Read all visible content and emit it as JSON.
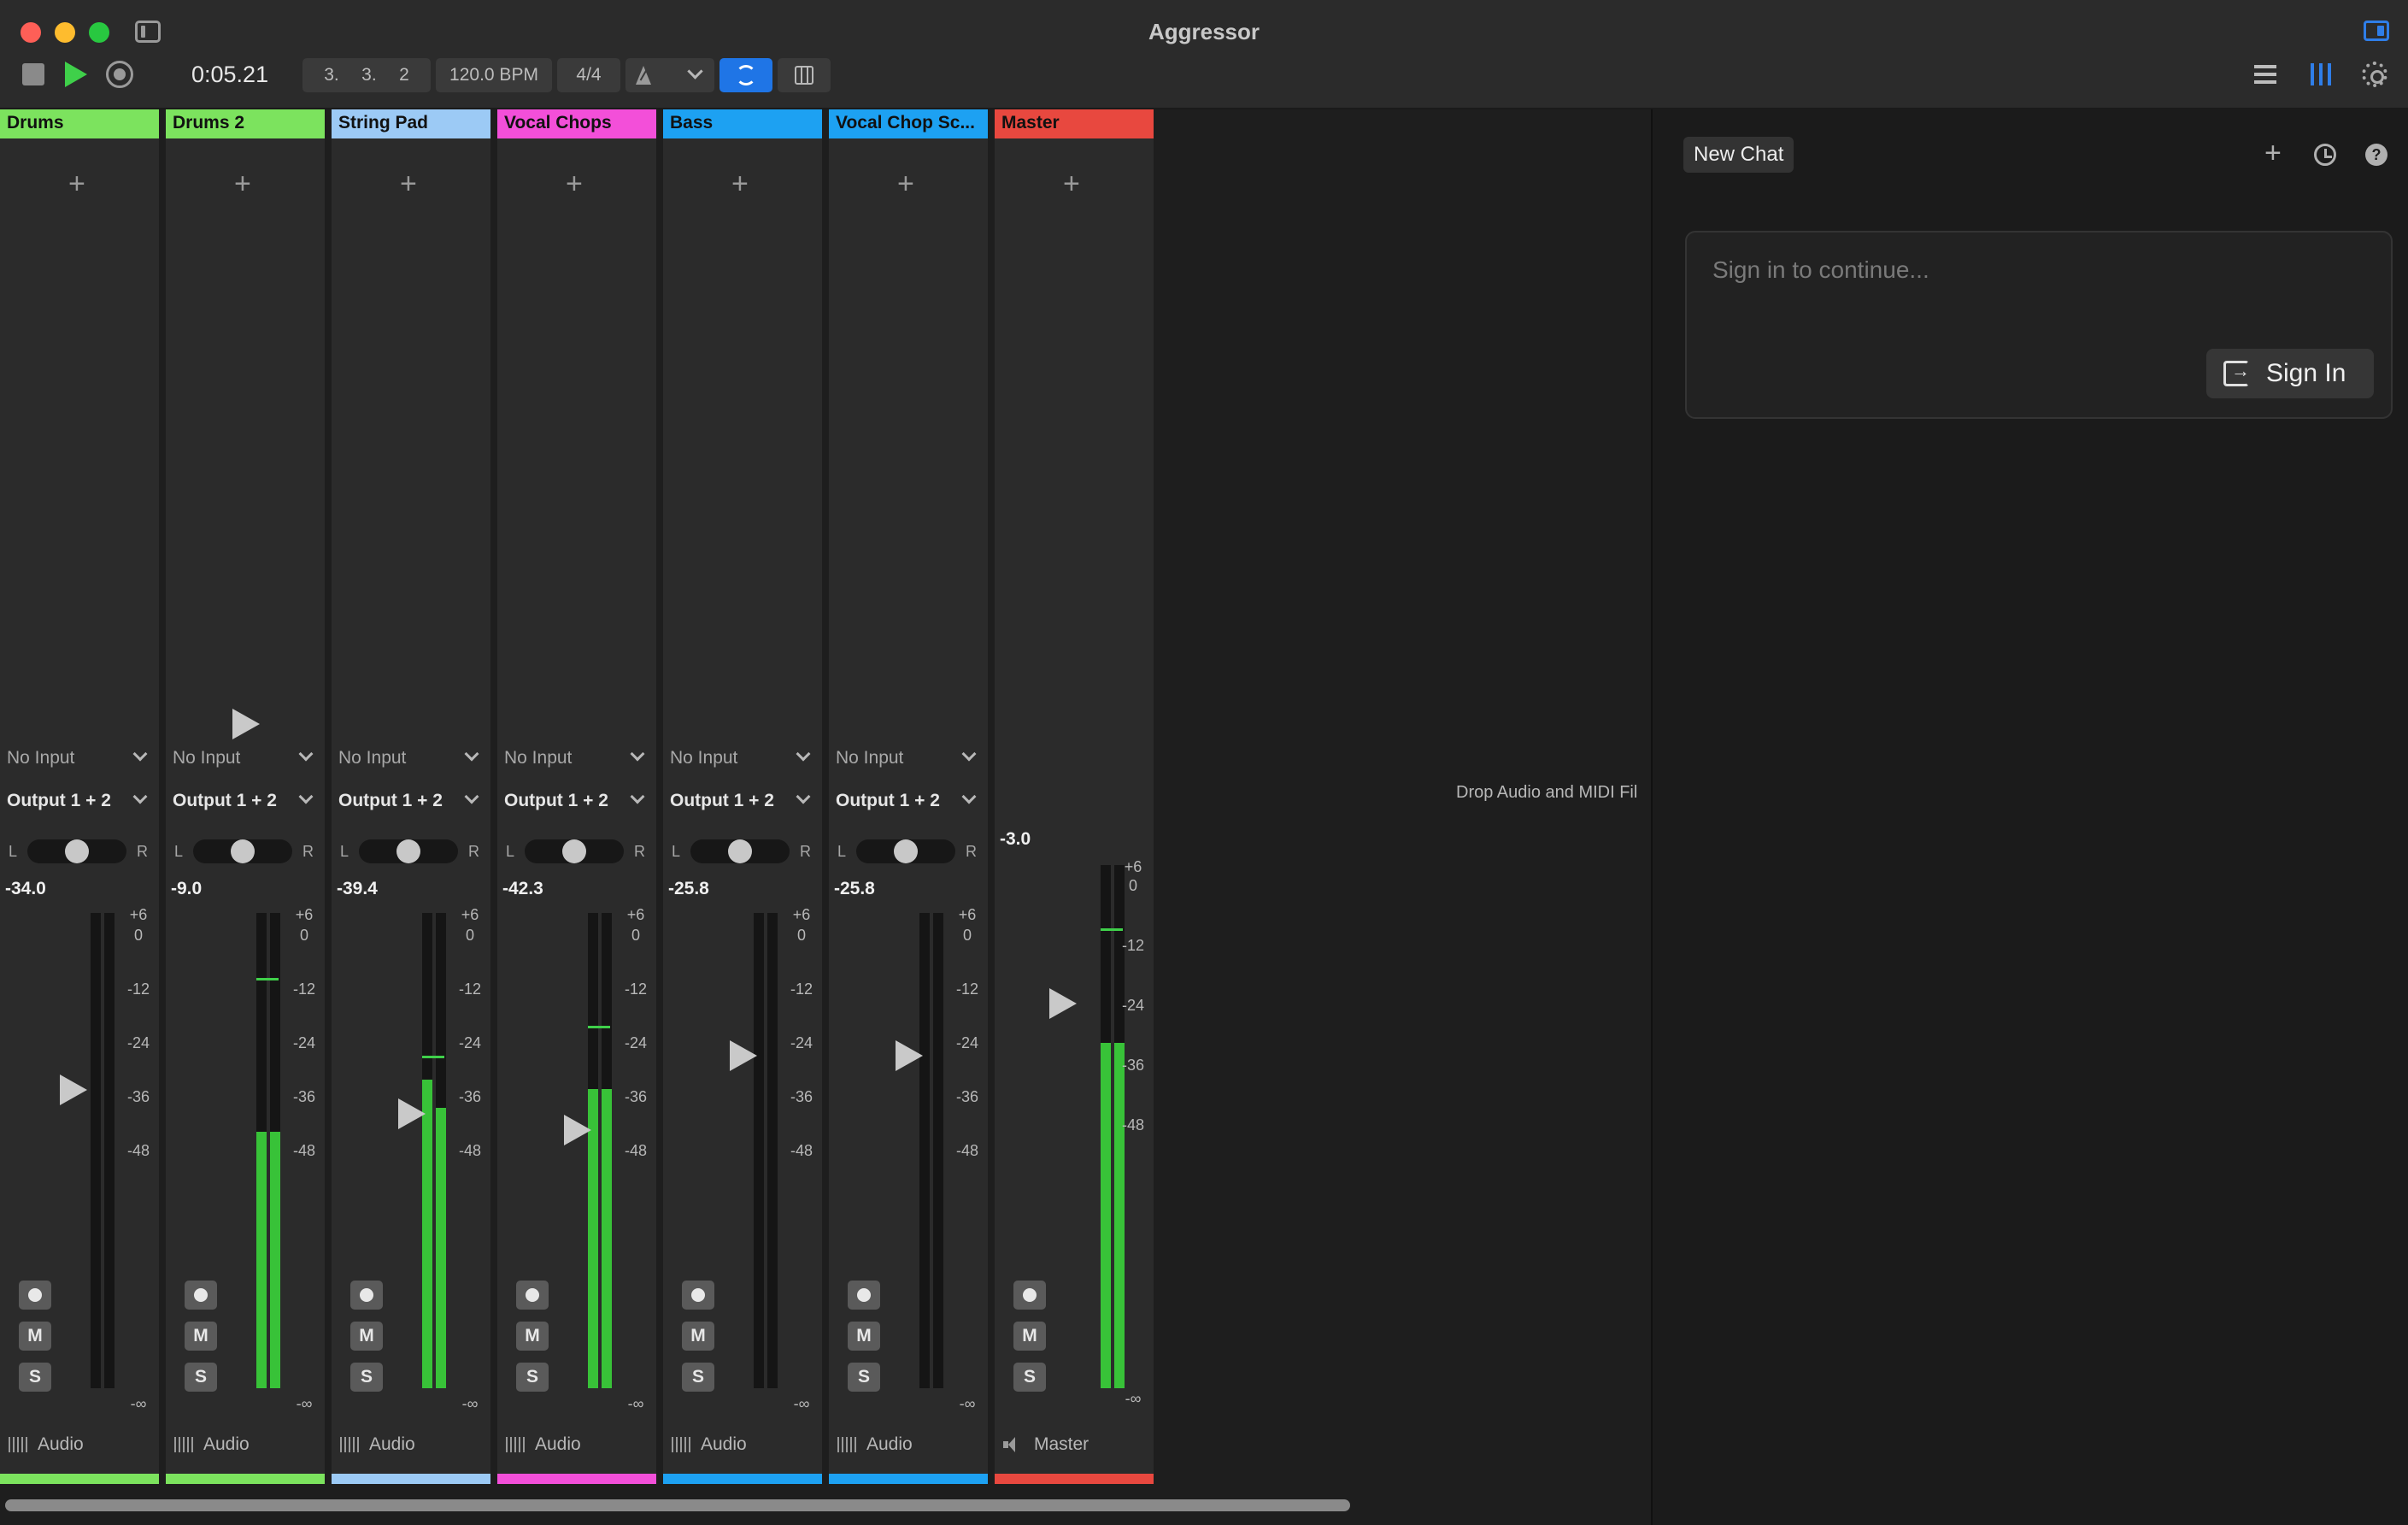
{
  "window": {
    "title": "Aggressor"
  },
  "transport": {
    "time": "0:05.21",
    "position": [
      "3.",
      "3.",
      "2"
    ],
    "bpm": "120.0 BPM",
    "time_signature": "4/4",
    "loop_enabled": true
  },
  "scale_labels": [
    "+6",
    "0",
    "-12",
    "-24",
    "-36",
    "-48",
    "-∞"
  ],
  "tracks": [
    {
      "name": "Drums",
      "color": "#7ce35e",
      "input": "No Input",
      "output": "Output 1 + 2",
      "pan_left": "L",
      "pan_right": "R",
      "pan": 0.0,
      "volume": "-34.0",
      "meter": [
        0.0,
        0.0
      ],
      "type": "Audio",
      "arm": "",
      "mute": "M",
      "solo": "S"
    },
    {
      "name": "Drums 2",
      "color": "#7ce35e",
      "input": "No Input",
      "output": "Output 1 + 2",
      "pan_left": "L",
      "pan_right": "R",
      "pan": 0.0,
      "volume": "-9.0",
      "meter": [
        0.54,
        0.54
      ],
      "type": "Audio",
      "arm": "",
      "mute": "M",
      "solo": "S"
    },
    {
      "name": "String Pad",
      "color": "#9ccaf5",
      "input": "No Input",
      "output": "Output 1 + 2",
      "pan_left": "L",
      "pan_right": "R",
      "pan": 0.0,
      "volume": "-39.4",
      "meter": [
        0.65,
        0.59
      ],
      "type": "Audio",
      "arm": "",
      "mute": "M",
      "solo": "S"
    },
    {
      "name": "Vocal Chops",
      "color": "#f34fd9",
      "input": "No Input",
      "output": "Output 1 + 2",
      "pan_left": "L",
      "pan_right": "R",
      "pan": 0.0,
      "volume": "-42.3",
      "meter": [
        0.63,
        0.63
      ],
      "type": "Audio",
      "arm": "",
      "mute": "M",
      "solo": "S"
    },
    {
      "name": "Bass",
      "color": "#1da1f2",
      "input": "No Input",
      "output": "Output 1 + 2",
      "pan_left": "L",
      "pan_right": "R",
      "pan": 0.0,
      "volume": "-25.8",
      "meter": [
        0.0,
        0.0
      ],
      "type": "Audio",
      "arm": "",
      "mute": "M",
      "solo": "S"
    },
    {
      "name": "Vocal Chop Sc...",
      "color": "#1da1f2",
      "input": "No Input",
      "output": "Output 1 + 2",
      "pan_left": "L",
      "pan_right": "R",
      "pan": 0.0,
      "volume": "-25.8",
      "meter": [
        0.0,
        0.0
      ],
      "type": "Audio",
      "arm": "",
      "mute": "M",
      "solo": "S"
    }
  ],
  "master": {
    "name": "Master",
    "color": "#e8483f",
    "volume": "-3.0",
    "meter": [
      0.66,
      0.66
    ],
    "type": "Master",
    "arm": "",
    "mute": "M",
    "solo": "S"
  },
  "mixer": {
    "drop_hint": "Drop Audio and MIDI Fil"
  },
  "chat": {
    "new_chat_label": "New Chat",
    "help_label": "?",
    "input_placeholder": "Sign in to continue...",
    "sign_in_label": "Sign In"
  }
}
